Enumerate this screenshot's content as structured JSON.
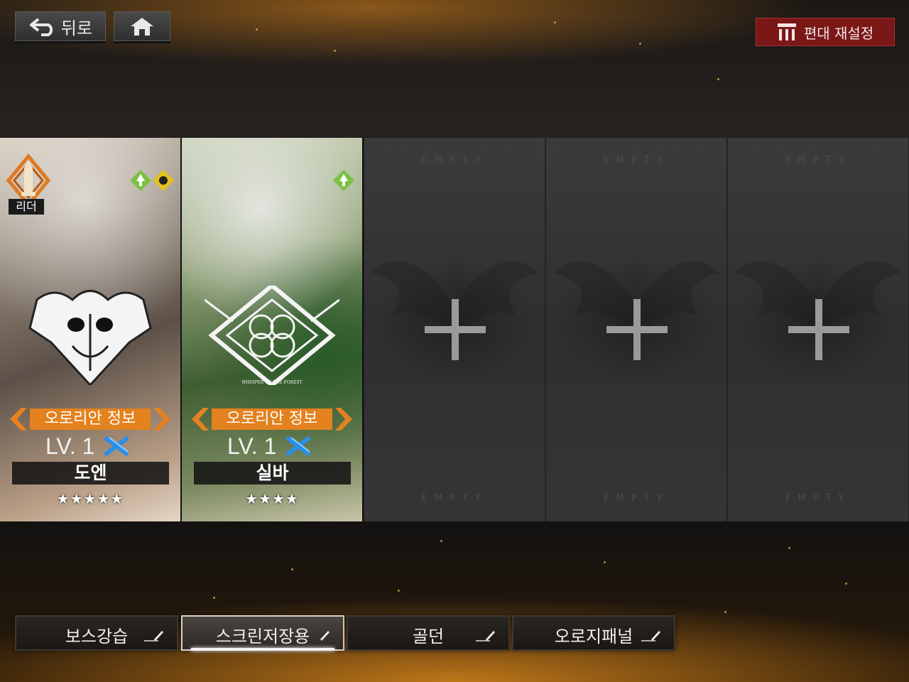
{
  "header": {
    "back_label": "뒤로",
    "reset_label": "편대 재설정"
  },
  "slots": [
    {
      "leader_label": "리더",
      "info_label": "오로리안 정보",
      "level": "LV. 1",
      "name": "도엔",
      "stars": "★★★★★",
      "star_count": 5
    },
    {
      "info_label": "오로리안 정보",
      "level": "LV. 1",
      "name": "실바",
      "stars": "★★★★",
      "star_count": 4,
      "emblem_caption": "WHISPER OF THE FOREST"
    },
    {
      "empty_top": "EMPTY",
      "empty_bottom": "EMPTY"
    },
    {
      "empty_top": "EMPTY",
      "empty_bottom": "EMPTY"
    },
    {
      "empty_top": "EMPTY",
      "empty_bottom": "EMPTY"
    }
  ],
  "tabs": [
    {
      "label": "보스강습",
      "active": false
    },
    {
      "label": "스크린저장용",
      "active": true
    },
    {
      "label": "골던",
      "active": false
    },
    {
      "label": "오로지패널",
      "active": false
    }
  ],
  "colors": {
    "accent_orange": "#e3821e",
    "reset_red": "#7a1717",
    "attribute_green": "#7bc142",
    "rank_blue": "#2a8fe8"
  },
  "icons": [
    "back-arrow-icon",
    "home-icon",
    "formation-icon",
    "plus-icon",
    "pencil-icon",
    "leader-crown-icon"
  ]
}
